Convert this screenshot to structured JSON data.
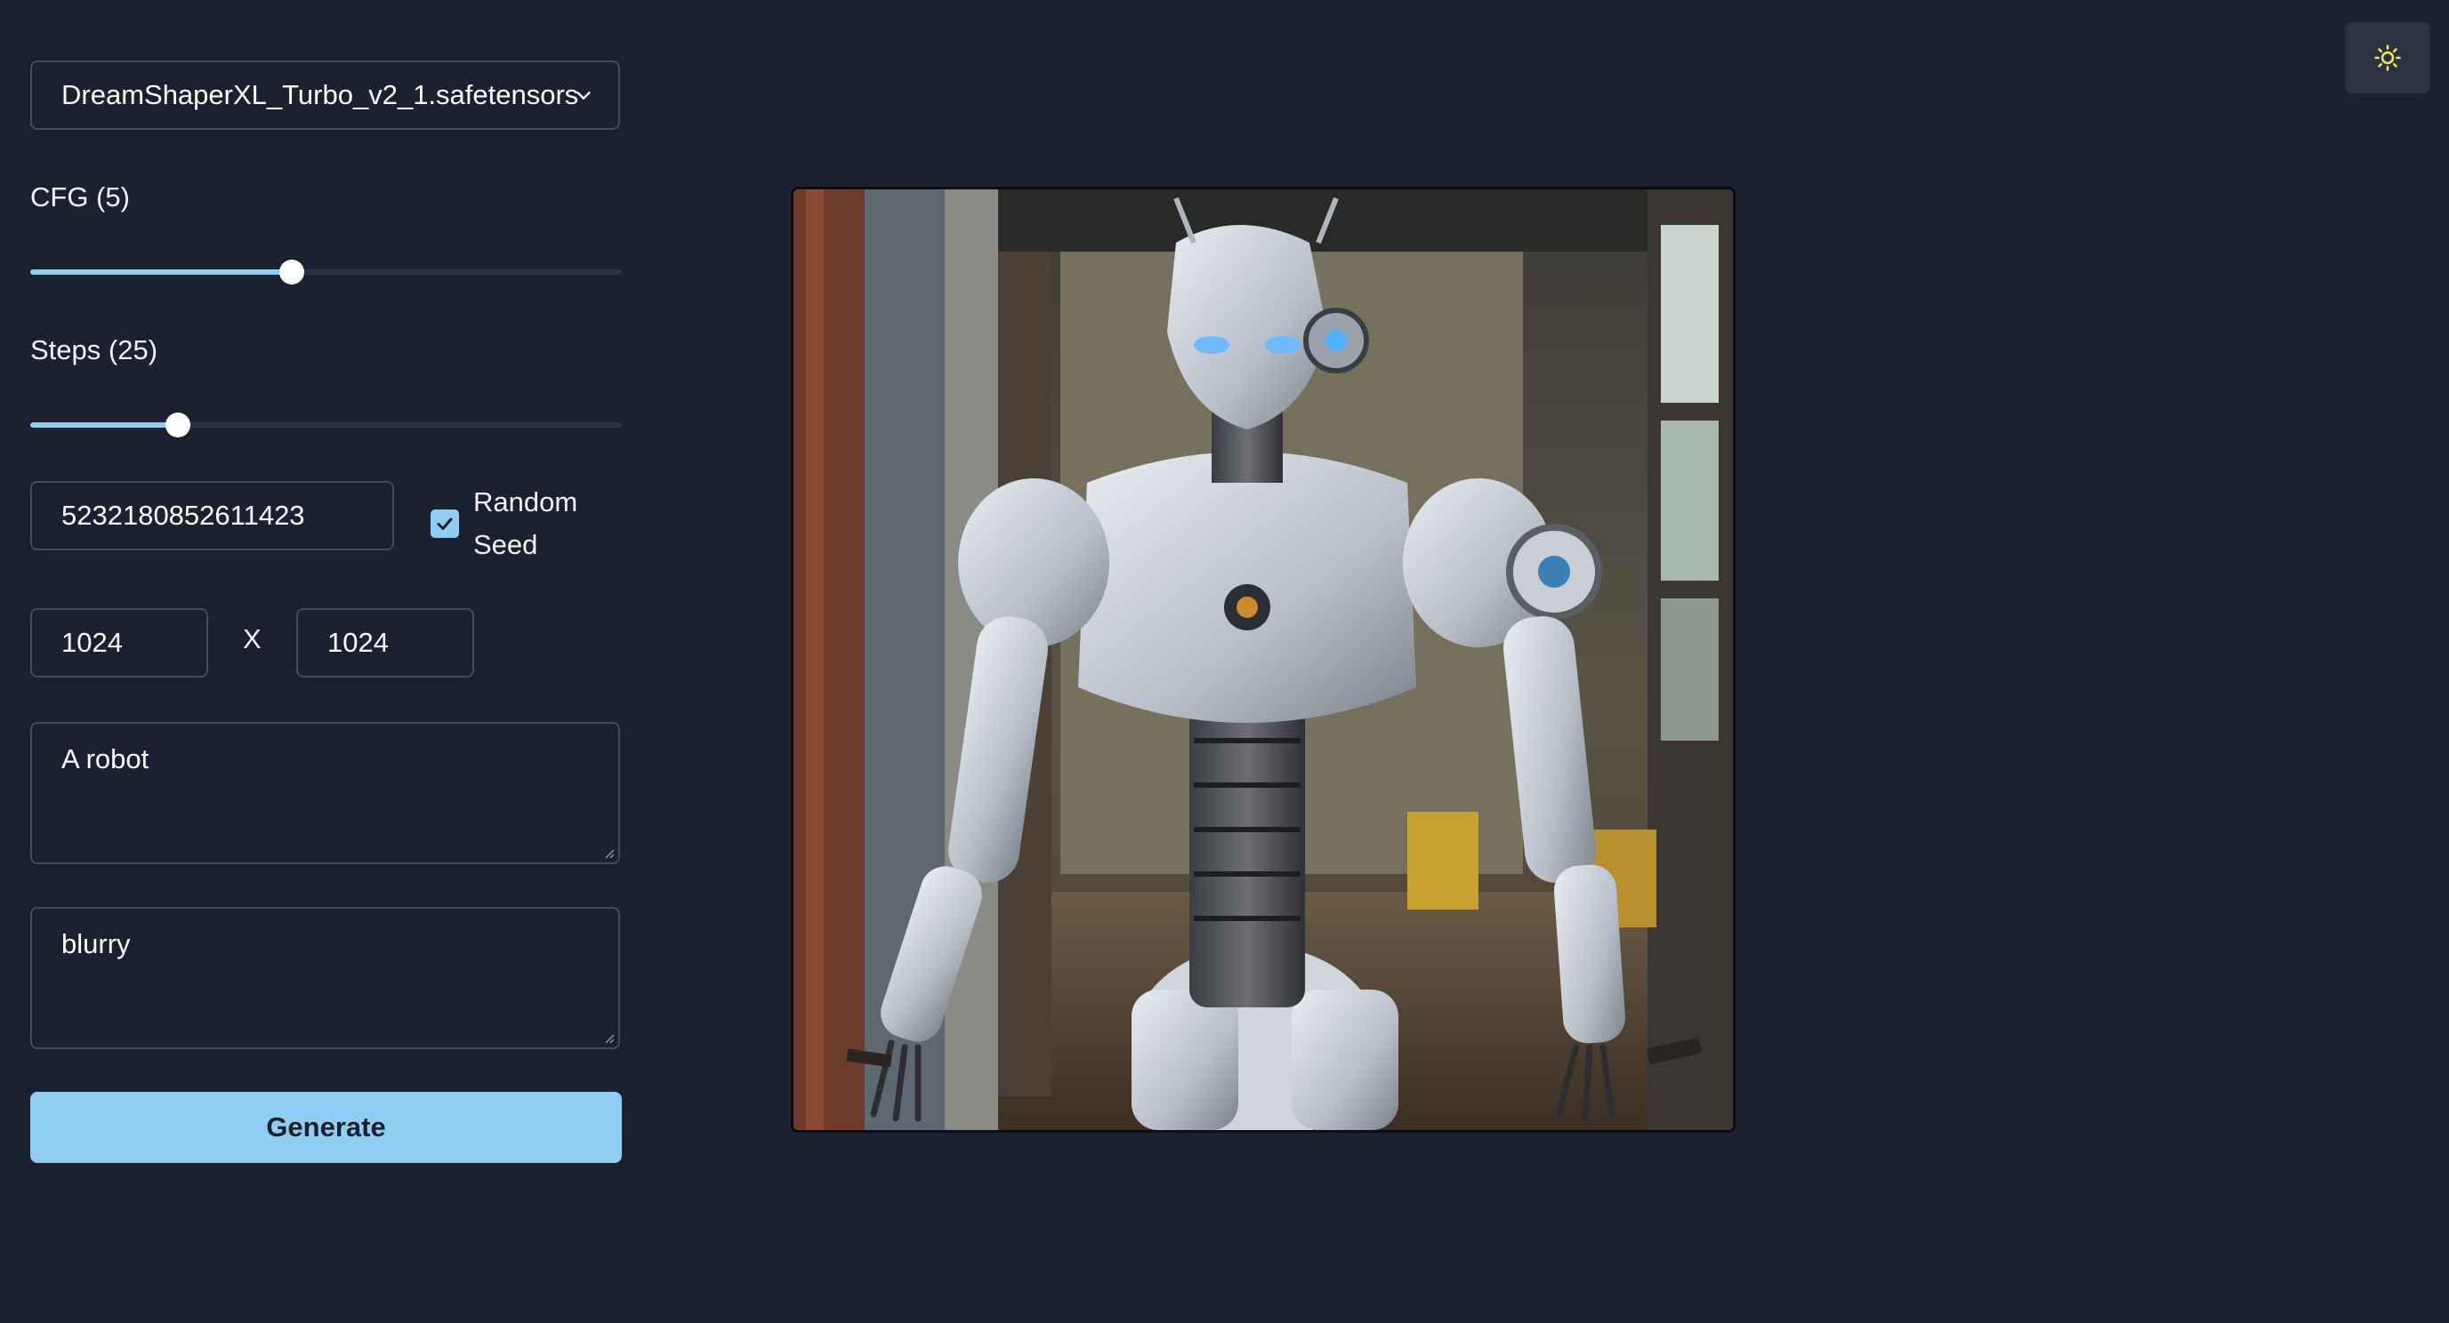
{
  "model_select": {
    "value": "DreamShaperXL_Turbo_v2_1.safetensors",
    "icon": "chevron-down-icon"
  },
  "cfg": {
    "label": "CFG (5)",
    "value": 5,
    "min": 0,
    "max": 11.3
  },
  "steps": {
    "label": "Steps (25)",
    "value": 25,
    "min": 0,
    "max": 100
  },
  "seed": {
    "value": "5232180852611423",
    "random_seed_label": "Random Seed",
    "random_seed_checked": true
  },
  "size": {
    "width": "1024",
    "separator": "X",
    "height": "1024"
  },
  "prompt": {
    "value": "A robot"
  },
  "negative_prompt": {
    "value": "blurry"
  },
  "generate_button": {
    "label": "Generate"
  },
  "theme_toggle": {
    "icon": "sun-icon"
  },
  "colors": {
    "background": "#1b2130",
    "accent": "#90cdf4",
    "border": "#434b5c"
  }
}
